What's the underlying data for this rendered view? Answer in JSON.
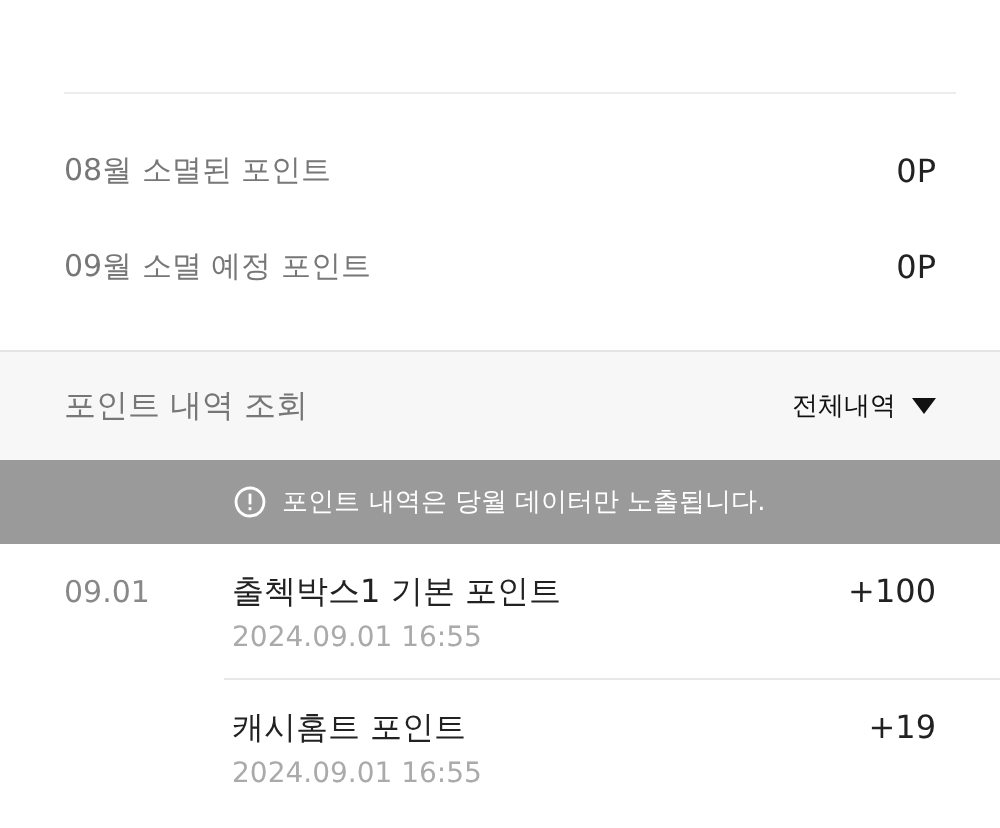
{
  "expiry_rows": [
    {
      "label": "08월 소멸된 포인트",
      "value": "0P"
    },
    {
      "label": "09월 소멸 예정 포인트",
      "value": "0P"
    }
  ],
  "history": {
    "title": "포인트 내역 조회",
    "filter": "전체내역",
    "notice": "포인트 내역은 당월 데이터만 노출됩니다.",
    "days": [
      {
        "date": "09.01",
        "entries": [
          {
            "title": "출첵박스1 기본 포인트",
            "time": "2024.09.01 16:55",
            "amount": "+100"
          },
          {
            "title": "캐시홈트 포인트",
            "time": "2024.09.01 16:55",
            "amount": "+19"
          }
        ]
      }
    ]
  }
}
